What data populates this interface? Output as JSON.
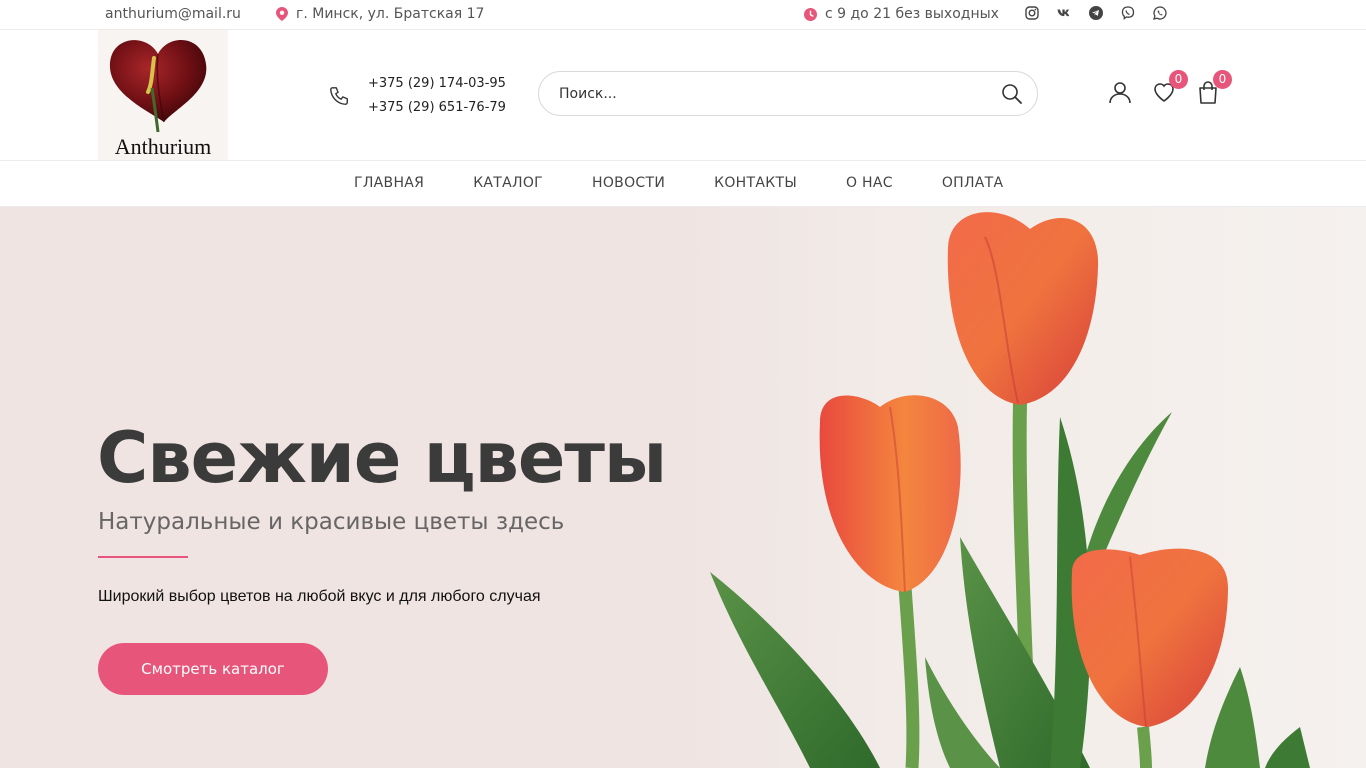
{
  "topbar": {
    "email": "anthurium@mail.ru",
    "address": "г. Минск, ул. Братская 17",
    "hours": "с 9 до 21 без выходных",
    "socials": [
      "instagram-icon",
      "vk-icon",
      "telegram-icon",
      "viber-icon",
      "whatsapp-icon"
    ]
  },
  "header": {
    "logo_text": "Anthurium",
    "phones": [
      "+375 (29) 174-03-95",
      "+375 (29) 651-76-79"
    ],
    "search_placeholder": "Поиск...",
    "wishlist_count": "0",
    "cart_count": "0"
  },
  "nav": {
    "items": [
      "ГЛАВНАЯ",
      "КАТАЛОГ",
      "НОВОСТИ",
      "КОНТАКТЫ",
      "О НАС",
      "ОПЛАТА"
    ]
  },
  "hero": {
    "title": "Свежие цветы",
    "subtitle": "Натуральные и красивые цветы здесь",
    "description": "Широкий выбор цветов на любой вкус и для любого случая",
    "cta_label": "Смотреть каталог"
  },
  "colors": {
    "accent": "#e8557a",
    "hero_bg": "#efe4e2",
    "heading": "#3b3b3b"
  }
}
